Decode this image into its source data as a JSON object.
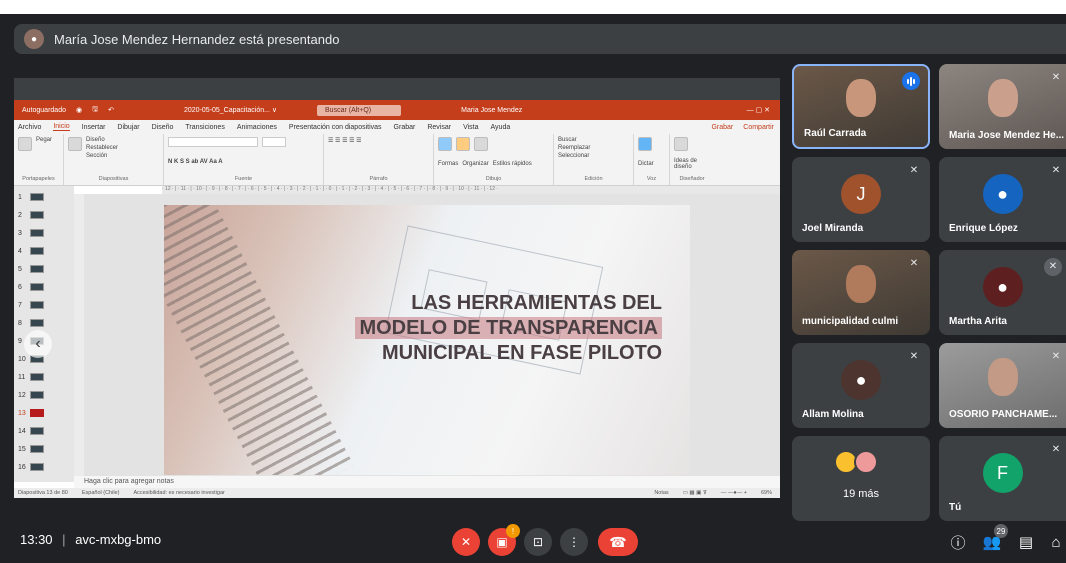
{
  "presenter_banner": "María Jose Mendez Hernandez está presentando",
  "ppt": {
    "autosave": "Autoguardado",
    "filename": "2020-05-05_Capacitación... ∨",
    "search": "Buscar (Alt+Q)",
    "user": "Maria Jose Mendez",
    "menu": [
      "Archivo",
      "Inicio",
      "Insertar",
      "Dibujar",
      "Diseño",
      "Transiciones",
      "Animaciones",
      "Presentación con diapositivas",
      "Grabar",
      "Revisar",
      "Vista",
      "Ayuda"
    ],
    "menu_right": [
      "Grabar",
      "Compartir"
    ],
    "ribbon_groups": [
      "Portapapeles",
      "Diapositivas",
      "Fuente",
      "Párrafo",
      "Dibujo",
      "Edición",
      "Voz",
      "Diseñador"
    ],
    "ribbon_items": {
      "pegar": "Pegar",
      "nueva": "Nueva diapositiva",
      "diseno": "Diseño",
      "restablecer": "Restablecer",
      "seccion": "Sección",
      "formas": "Formas",
      "organizar": "Organizar",
      "estilos": "Estilos rápidos",
      "buscar": "Buscar",
      "reemplazar": "Reemplazar",
      "seleccionar": "Seleccionar",
      "dictar": "Dictar",
      "ideas": "Ideas de diseño"
    },
    "slide_numbers": [
      "1",
      "2",
      "3",
      "4",
      "5",
      "6",
      "7",
      "8",
      "9",
      "10",
      "11",
      "12",
      "13",
      "14",
      "15",
      "16"
    ],
    "selected_slide": "13",
    "slide_title_lines": [
      "LAS HERRAMIENTAS DEL",
      "MODELO DE TRANSPARENCIA",
      "MUNICIPAL EN FASE PILOTO"
    ],
    "notes_placeholder": "Haga clic para agregar notas",
    "status_left": "Diapositiva 13 de 80",
    "status_lang": "Español (Chile)",
    "status_access": "Accesibilidad: es necesario investigar",
    "status_notes": "Notas",
    "status_zoom": "69%"
  },
  "participants": [
    {
      "name": "Raúl Carrada",
      "speaking": true
    },
    {
      "name": "Maria Jose Mendez He..."
    },
    {
      "name": "Joel Miranda",
      "initial": "J",
      "color": "#a0522d"
    },
    {
      "name": "Enrique López"
    },
    {
      "name": "municipalidad culmi"
    },
    {
      "name": "Martha Arita"
    },
    {
      "name": "Allam Molina"
    },
    {
      "name": "OSORIO PANCHAME..."
    },
    {
      "name": "19 más"
    },
    {
      "name": "Tú",
      "initial": "F",
      "color": "#12a36b"
    }
  ],
  "bottom": {
    "time": "13:30",
    "separator": "|",
    "meeting_code": "avc-mxbg-bmo",
    "camera_badge": "!",
    "people_count": "29"
  },
  "colors": {
    "meet_bg": "#202124",
    "tile_bg": "#3c4043",
    "ppt_accent": "#c43e1c",
    "hangup_red": "#ea4335",
    "active_border": "#8ab4f8"
  }
}
